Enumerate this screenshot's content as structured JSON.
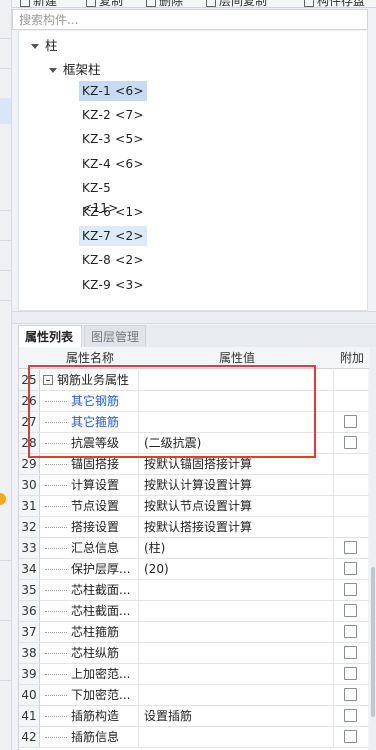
{
  "toolbar": {
    "items": [
      "新建",
      "复制",
      "删除",
      "层间复制",
      "构件存盘"
    ]
  },
  "search": {
    "placeholder": "搜索构件..."
  },
  "tree": {
    "root_label": "柱",
    "group_label": "框架柱",
    "items": [
      {
        "label": "KZ-1 <6>",
        "state": "selected"
      },
      {
        "label": "KZ-2 <7>",
        "state": ""
      },
      {
        "label": "KZ-3 <5>",
        "state": ""
      },
      {
        "label": "KZ-4 <6>",
        "state": ""
      },
      {
        "label": "KZ-5 <11>",
        "state": ""
      },
      {
        "label": "KZ-6 <1>",
        "state": ""
      },
      {
        "label": "KZ-7 <2>",
        "state": "hover"
      },
      {
        "label": "KZ-8 <2>",
        "state": ""
      },
      {
        "label": "KZ-9 <3>",
        "state": ""
      }
    ]
  },
  "tabs": [
    {
      "label": "属性列表",
      "active": true
    },
    {
      "label": "图层管理",
      "active": false
    }
  ],
  "grid": {
    "headers": {
      "name": "属性名称",
      "value": "属性值",
      "add": "附加"
    },
    "rows": [
      {
        "num": "25",
        "name": "钢筋业务属性",
        "value": "",
        "checkbox": false,
        "group": true,
        "blue": false
      },
      {
        "num": "26",
        "name": "其它钢筋",
        "value": "",
        "checkbox": false,
        "group": false,
        "blue": true
      },
      {
        "num": "27",
        "name": "其它箍筋",
        "value": "",
        "checkbox": true,
        "group": false,
        "blue": true
      },
      {
        "num": "28",
        "name": "抗震等级",
        "value": "(二级抗震)",
        "checkbox": true,
        "group": false,
        "blue": false
      },
      {
        "num": "29",
        "name": "锚固搭接",
        "value": "按默认锚固搭接计算",
        "checkbox": false,
        "group": false,
        "blue": false
      },
      {
        "num": "30",
        "name": "计算设置",
        "value": "按默认计算设置计算",
        "checkbox": false,
        "group": false,
        "blue": false
      },
      {
        "num": "31",
        "name": "节点设置",
        "value": "按默认节点设置计算",
        "checkbox": false,
        "group": false,
        "blue": false
      },
      {
        "num": "32",
        "name": "搭接设置",
        "value": "按默认搭接设置计算",
        "checkbox": false,
        "group": false,
        "blue": false
      },
      {
        "num": "33",
        "name": "汇总信息",
        "value": "(柱)",
        "checkbox": true,
        "group": false,
        "blue": false
      },
      {
        "num": "34",
        "name": "保护层厚...",
        "value": "(20)",
        "checkbox": true,
        "group": false,
        "blue": false
      },
      {
        "num": "35",
        "name": "芯柱截面...",
        "value": "",
        "checkbox": true,
        "group": false,
        "blue": false
      },
      {
        "num": "36",
        "name": "芯柱截面...",
        "value": "",
        "checkbox": true,
        "group": false,
        "blue": false
      },
      {
        "num": "37",
        "name": "芯柱箍筋",
        "value": "",
        "checkbox": true,
        "group": false,
        "blue": false
      },
      {
        "num": "38",
        "name": "芯柱纵筋",
        "value": "",
        "checkbox": true,
        "group": false,
        "blue": false
      },
      {
        "num": "39",
        "name": "上加密范...",
        "value": "",
        "checkbox": true,
        "group": false,
        "blue": false
      },
      {
        "num": "40",
        "name": "下加密范...",
        "value": "",
        "checkbox": true,
        "group": false,
        "blue": false
      },
      {
        "num": "41",
        "name": "插筋构造",
        "value": "设置插筋",
        "checkbox": true,
        "group": false,
        "blue": false
      },
      {
        "num": "42",
        "name": "插筋信息",
        "value": "",
        "checkbox": true,
        "group": false,
        "blue": false
      }
    ]
  },
  "colors": {
    "selection": "#c6daf3",
    "hover": "#dceaf8",
    "link_blue": "#1f5fd6",
    "highlight_red": "#e23b3b"
  }
}
